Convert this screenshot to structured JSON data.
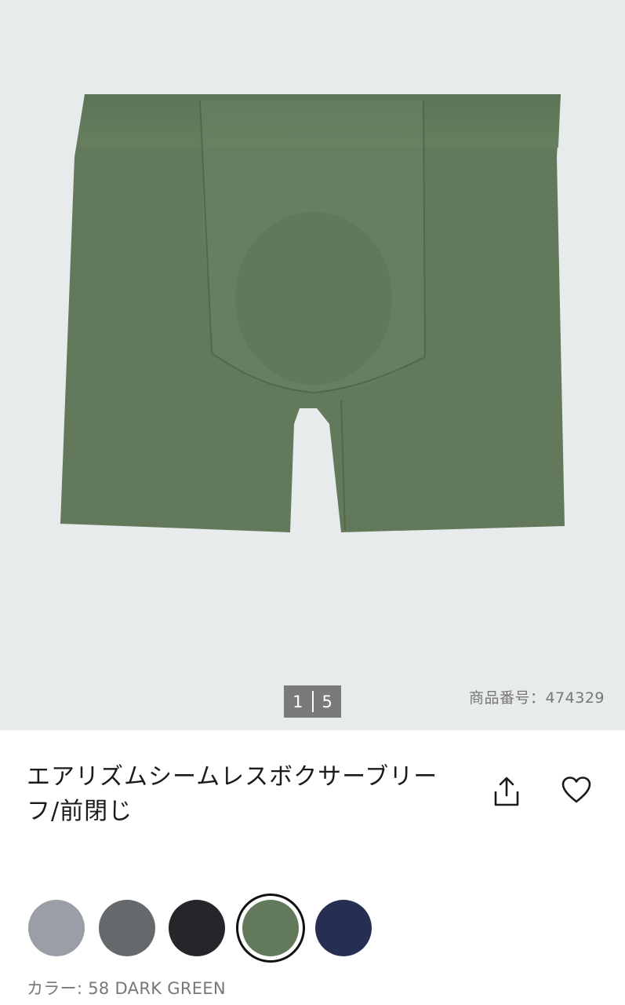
{
  "gallery": {
    "pager": {
      "current": "1",
      "total": "5"
    },
    "product_number": "商品番号：474329"
  },
  "product": {
    "title": "エアリズムシームレスボクサーブリーフ/前閉じ"
  },
  "actions": {
    "share_icon": "share-icon",
    "favorite_icon": "heart-icon"
  },
  "colors": {
    "options": [
      {
        "name": "light-gray",
        "hex": "#9a9ea6"
      },
      {
        "name": "gray",
        "hex": "#66696c"
      },
      {
        "name": "black",
        "hex": "#24262a"
      },
      {
        "name": "dark-green",
        "hex": "#627a5b",
        "selected": true
      },
      {
        "name": "navy",
        "hex": "#262f52"
      }
    ],
    "selected_label": "カラー: 58 DARK GREEN"
  },
  "theme": {
    "garment_color": "#627a5b",
    "hero_background": "#e8ebec",
    "pager_background": "#7a7a7a"
  }
}
